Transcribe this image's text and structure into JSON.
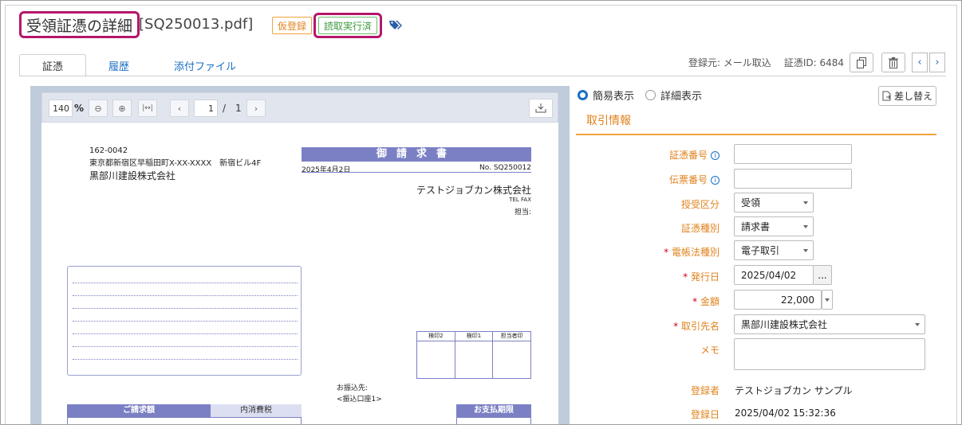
{
  "header": {
    "title": "受領証憑の詳細",
    "filename": "[SQ250013.pdf]",
    "badge_provisional": "仮登録",
    "badge_ocr": "読取実行済"
  },
  "tabs": [
    {
      "label": "証憑"
    },
    {
      "label": "履歴"
    },
    {
      "label": "添付ファイル"
    }
  ],
  "meta": {
    "source": "登録元: メール取込",
    "doc_id": "証憑ID: 6484"
  },
  "viewer": {
    "zoom_value": "140",
    "zoom_unit": "%",
    "page_current": "1",
    "page_sep": "/",
    "page_total": "1"
  },
  "invoice": {
    "postal": "162-0042",
    "address": "東京都新宿区早稲田町X-XX-XXXX　新宿ビル4F",
    "recipient": "黒部川建設株式会社",
    "title": "御請求書",
    "date": "2025年4月2日",
    "number": "No. SQ250012",
    "issuer": "テストジョブカン株式会社",
    "tel_fax": "TEL FAX",
    "contact": "担当:",
    "stamps": [
      "検印2",
      "検印1",
      "担当者印"
    ],
    "transfer_label": "お振込先:",
    "transfer_account": "<振込口座1>",
    "billing_amount_header": "ご請求額",
    "tax_header": "内消費税",
    "due_header": "お支払期限"
  },
  "form": {
    "view_simple": "簡易表示",
    "view_detail": "詳細表示",
    "replace_button": "差し替え",
    "section_title": "取引情報",
    "fields": {
      "doc_number": {
        "label": "証憑番号",
        "value": ""
      },
      "slip_number": {
        "label": "伝票番号",
        "value": ""
      },
      "transfer_type": {
        "label": "授受区分",
        "value": "受領"
      },
      "doc_type": {
        "label": "証憑種別",
        "value": "請求書"
      },
      "ebook_type": {
        "label": "電帳法種別",
        "value": "電子取引"
      },
      "issue_date": {
        "label": "発行日",
        "value": "2025/04/02",
        "picker": "..."
      },
      "amount": {
        "label": "金額",
        "value": "22,000"
      },
      "partner": {
        "label": "取引先名",
        "value": "黒部川建設株式会社"
      },
      "memo": {
        "label": "メモ",
        "value": ""
      },
      "registrant": {
        "label": "登録者",
        "value": "テストジョブカン サンプル"
      },
      "registered_at": {
        "label": "登録日",
        "value": "2025/04/02 15:32:36"
      }
    },
    "required_mark": "*",
    "info_mark": "i"
  },
  "colors": {
    "accent_orange": "#e0821c",
    "highlight_magenta": "#b5166b",
    "link_blue": "#1a6fc4",
    "invoice_purple": "#7b80c4"
  }
}
